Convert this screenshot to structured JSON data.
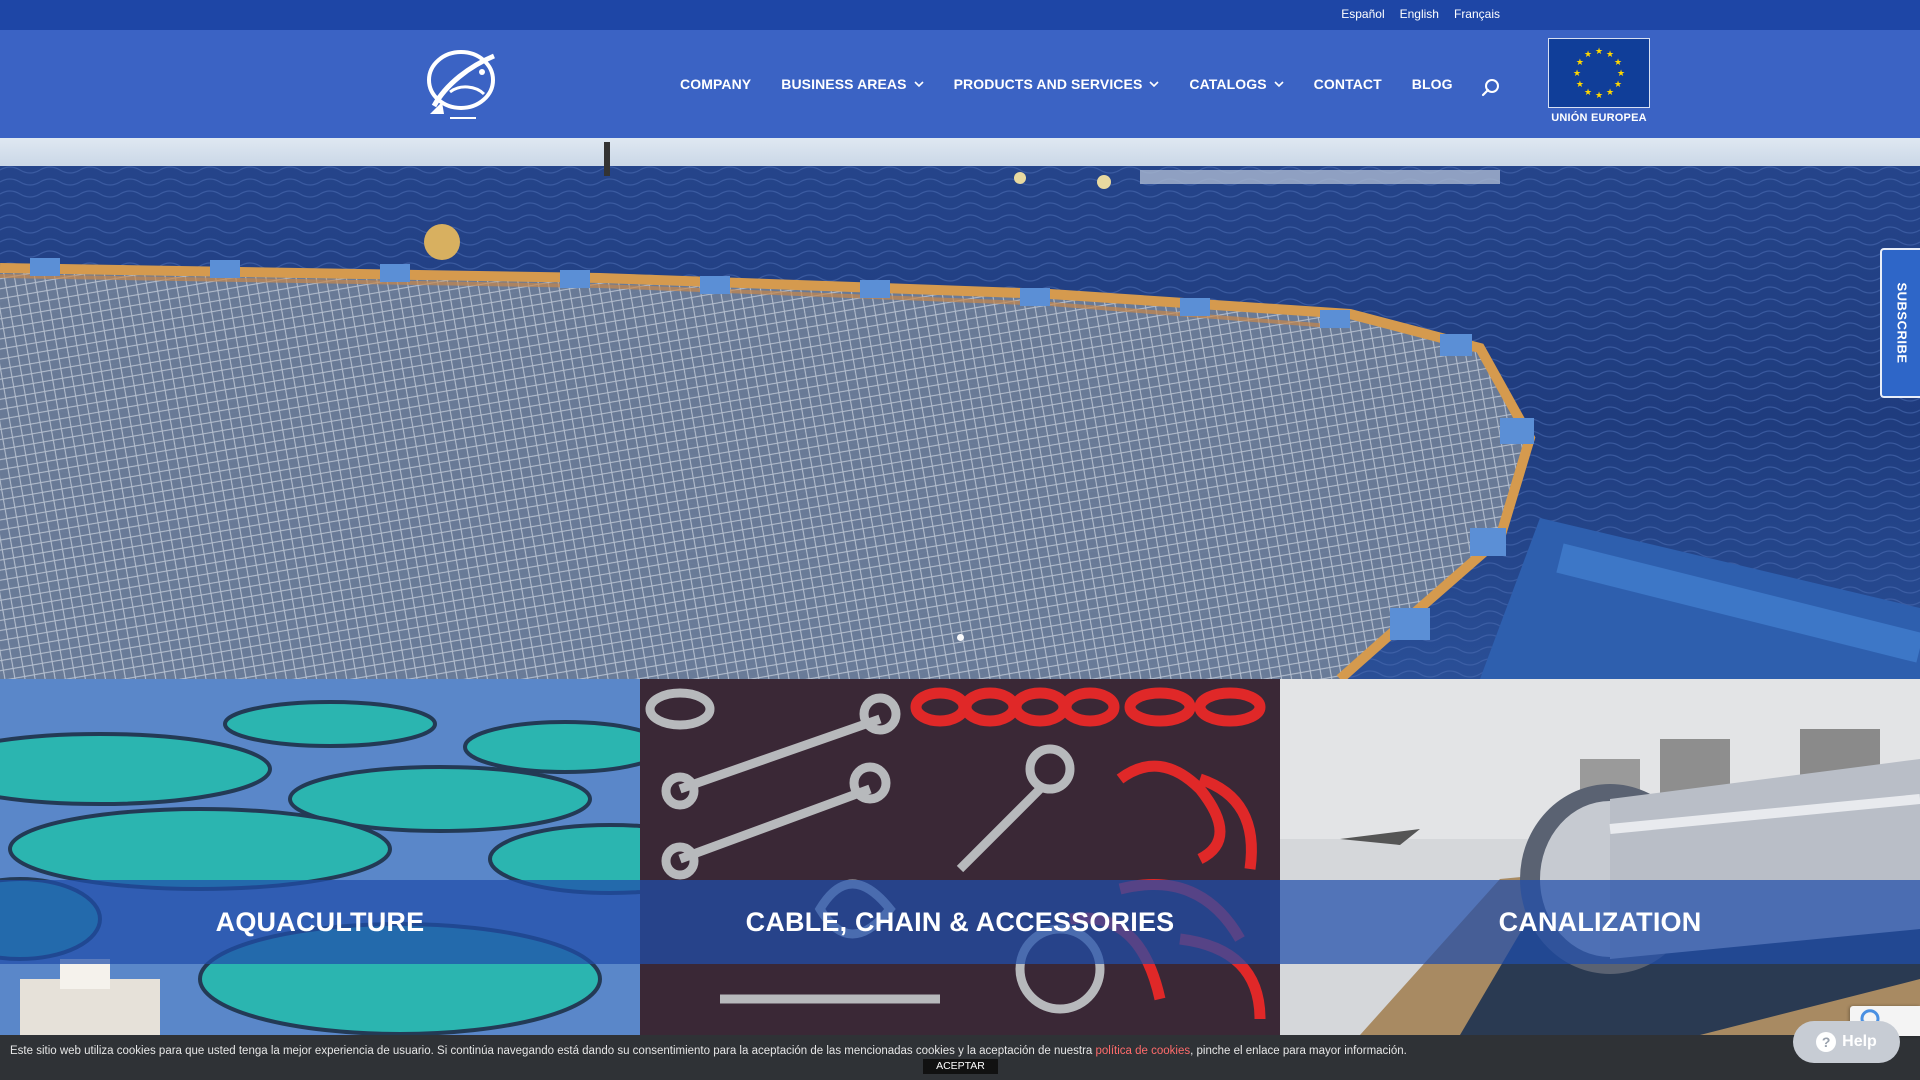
{
  "languages": [
    "Español",
    "English",
    "Français"
  ],
  "nav": {
    "items": [
      {
        "label": "COMPANY",
        "dropdown": false
      },
      {
        "label": "BUSINESS AREAS",
        "dropdown": true
      },
      {
        "label": "PRODUCTS AND SERVICES",
        "dropdown": true
      },
      {
        "label": "CATALOGS",
        "dropdown": true
      },
      {
        "label": "CONTACT",
        "dropdown": false
      },
      {
        "label": "BLOG",
        "dropdown": false
      }
    ],
    "search_icon": "search-icon"
  },
  "eu_badge": {
    "label": "UNIÓN EUROPEA"
  },
  "subscribe": {
    "label": "SUBSCRIBE"
  },
  "hero": {
    "slides": 1,
    "active_slide": 0
  },
  "tiles": [
    {
      "title": "AQUACULTURE"
    },
    {
      "title": "CABLE, CHAIN & ACCESSORIES"
    },
    {
      "title": "CANALIZATION"
    }
  ],
  "cookie": {
    "text_before": "Este sitio web utiliza cookies para que usted tenga la mejor experiencia de usuario. Si continúa navegando está dando su consentimiento para la aceptación de las mencionadas cookies y la aceptación de nuestra ",
    "link": "política de cookies",
    "text_after": ", pinche el enlace para mayor información.",
    "accept": "ACEPTAR"
  },
  "help": {
    "label": "Help",
    "icon": "?"
  },
  "colors": {
    "topbar": "#1e46a6",
    "header": "#3b63c4",
    "cookie_bar": "#2f3236",
    "link": "#ff6b6b"
  }
}
